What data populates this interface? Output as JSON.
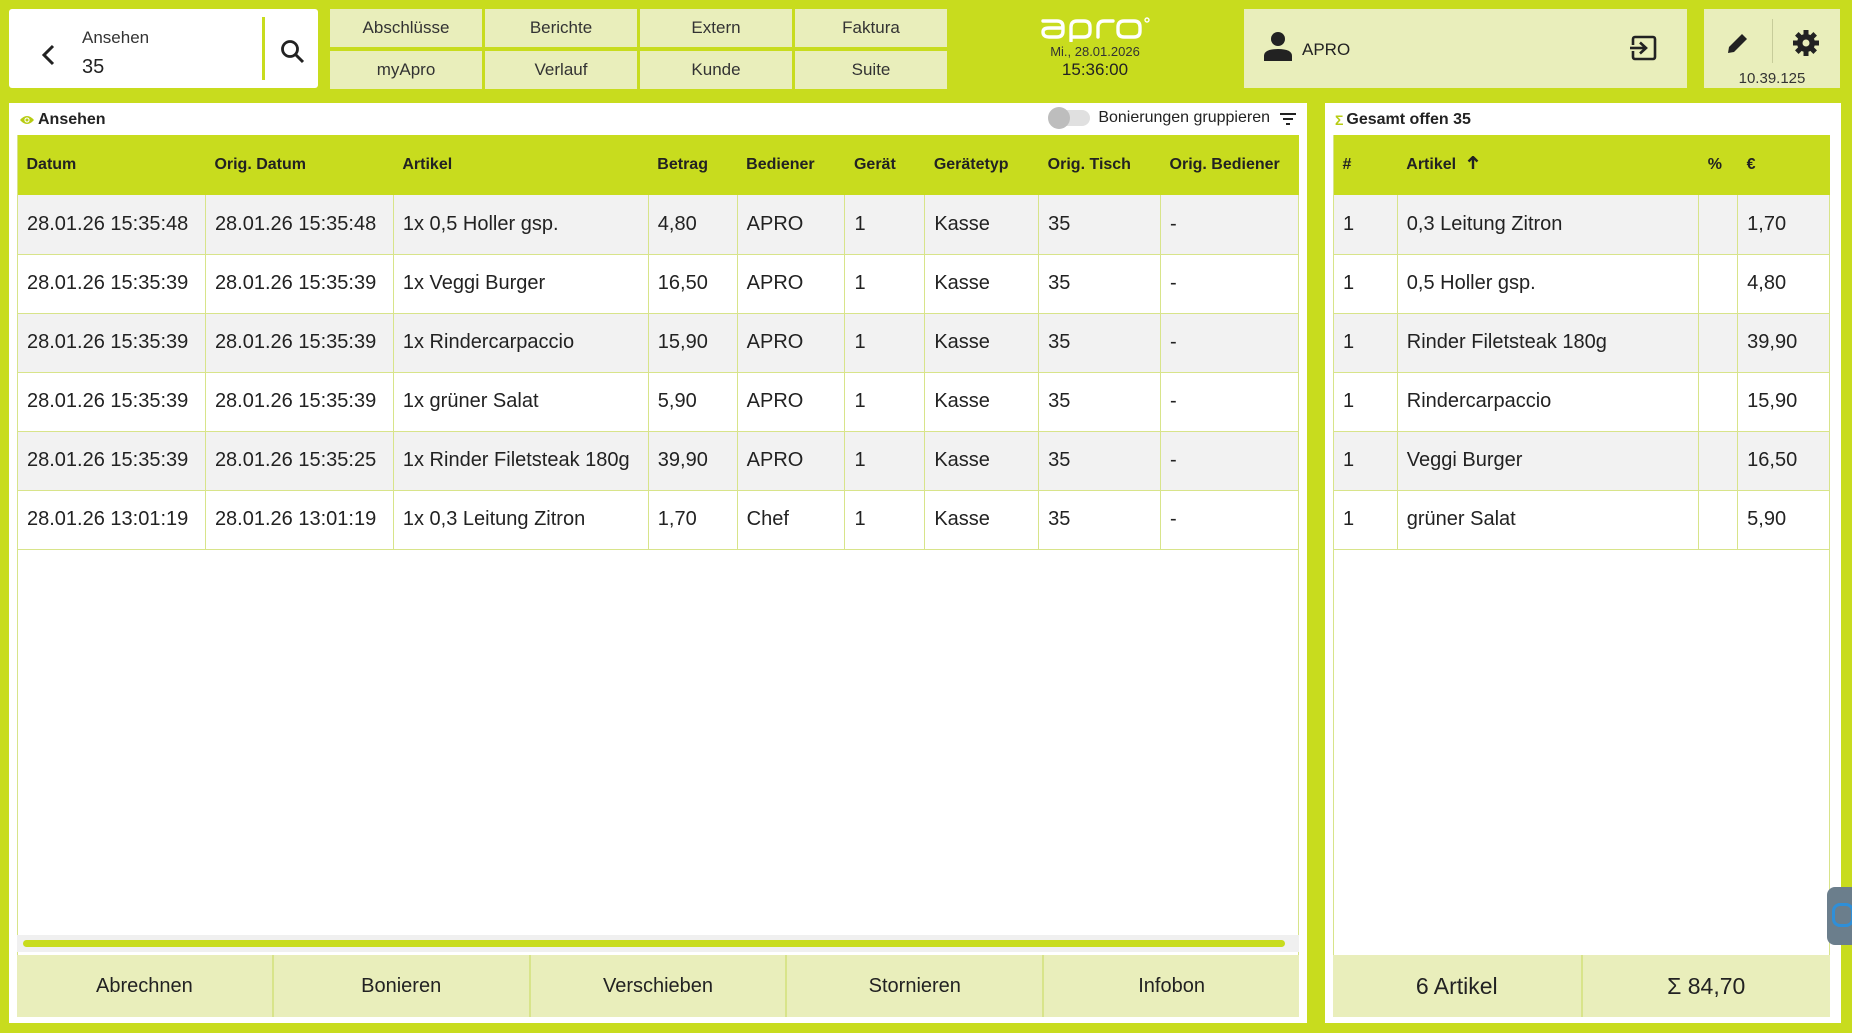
{
  "search": {
    "label": "Ansehen",
    "value": "35"
  },
  "nav": [
    "Abschlüsse",
    "Berichte",
    "Extern",
    "Faktura",
    "myApro",
    "Verlauf",
    "Kunde",
    "Suite"
  ],
  "header": {
    "date": "Mi., 28.01.2026",
    "time": "15:36:00"
  },
  "user": {
    "name": "APRO"
  },
  "version": "10.39.125",
  "colors": {
    "accent": "#c8dc1e",
    "light": "#e9eebb"
  },
  "left_panel": {
    "title": "Ansehen",
    "toggle_label": "Bonierungen gruppieren",
    "columns": [
      "Datum",
      "Orig. Datum",
      "Artikel",
      "Betrag",
      "Bediener",
      "Gerät",
      "Gerätetyp",
      "Orig. Tisch",
      "Orig. Bediener"
    ],
    "rows": [
      [
        "28.01.26 15:35:48",
        "28.01.26 15:35:48",
        "1x 0,5 Holler gsp.",
        "4,80",
        "APRO",
        "1",
        "Kasse",
        "35",
        "-"
      ],
      [
        "28.01.26 15:35:39",
        "28.01.26 15:35:39",
        "1x Veggi Burger",
        "16,50",
        "APRO",
        "1",
        "Kasse",
        "35",
        "-"
      ],
      [
        "28.01.26 15:35:39",
        "28.01.26 15:35:39",
        "1x Rindercarpaccio",
        "15,90",
        "APRO",
        "1",
        "Kasse",
        "35",
        "-"
      ],
      [
        "28.01.26 15:35:39",
        "28.01.26 15:35:39",
        "1x grüner Salat",
        "5,90",
        "APRO",
        "1",
        "Kasse",
        "35",
        "-"
      ],
      [
        "28.01.26 15:35:39",
        "28.01.26 15:35:25",
        "1x Rinder Filetsteak 180g",
        "39,90",
        "APRO",
        "1",
        "Kasse",
        "35",
        "-"
      ],
      [
        "28.01.26 13:01:19",
        "28.01.26 13:01:19",
        "1x 0,3 Leitung Zitron",
        "1,70",
        "Chef",
        "1",
        "Kasse",
        "35",
        "-"
      ]
    ],
    "actions": [
      "Abrechnen",
      "Bonieren",
      "Verschieben",
      "Stornieren",
      "Infobon"
    ]
  },
  "right_panel": {
    "title": "Gesamt offen 35",
    "columns": [
      "#",
      "Artikel",
      "%",
      "€"
    ],
    "rows": [
      [
        "1",
        "0,3 Leitung Zitron",
        "",
        "1,70"
      ],
      [
        "1",
        "0,5 Holler gsp.",
        "",
        "4,80"
      ],
      [
        "1",
        "Rinder Filetsteak 180g",
        "",
        "39,90"
      ],
      [
        "1",
        "Rindercarpaccio",
        "",
        "15,90"
      ],
      [
        "1",
        "Veggi Burger",
        "",
        "16,50"
      ],
      [
        "1",
        "grüner Salat",
        "",
        "5,90"
      ]
    ],
    "count_label": "6 Artikel",
    "total_label": "Σ 84,70"
  }
}
